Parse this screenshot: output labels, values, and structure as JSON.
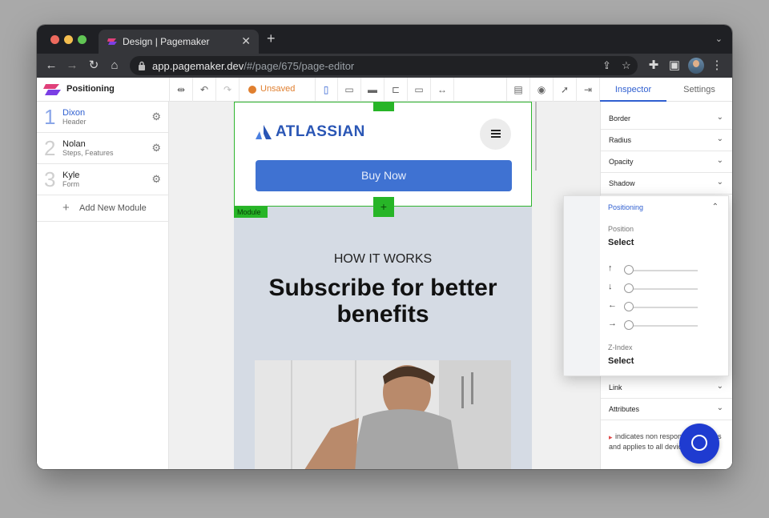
{
  "browser": {
    "tab_title": "Design | Pagemaker",
    "url_host": "app.pagemaker.dev",
    "url_path": "/#/page/675/page-editor"
  },
  "app": {
    "selected_title": "Positioning",
    "status": "Unsaved",
    "inspector_tabs": [
      "Inspector",
      "Settings"
    ]
  },
  "modules": [
    {
      "number": "1",
      "name": "Dixon",
      "type": "Header"
    },
    {
      "number": "2",
      "name": "Nolan",
      "type": "Steps, Features"
    },
    {
      "number": "3",
      "name": "Kyle",
      "type": "Form"
    }
  ],
  "add_module_label": "Add New Module",
  "canvas": {
    "brand": "ATLASSIAN",
    "cta": "Buy Now",
    "module_tag": "Module",
    "eyebrow": "HOW IT WORKS",
    "headline": "Subscribe for better benefits"
  },
  "inspector": {
    "sections_top": [
      "Border",
      "Radius",
      "Opacity",
      "Shadow"
    ],
    "sections_bottom": [
      "Link",
      "Attributes"
    ],
    "note": "indicates non responsive settings and applies to all device sizes."
  },
  "positioning": {
    "title": "Positioning",
    "position_label": "Position",
    "position_value": "Select",
    "sliders": [
      {
        "direction": "top",
        "value": 0
      },
      {
        "direction": "bottom",
        "value": 0
      },
      {
        "direction": "left",
        "value": 0
      },
      {
        "direction": "right",
        "value": 0
      }
    ],
    "zindex_label": "Z-Index",
    "zindex_value": "Select"
  },
  "colors": {
    "accent": "#2f5fd0",
    "selection": "#27b527",
    "unsaved": "#e07f2f",
    "cta": "#3f72d2"
  }
}
